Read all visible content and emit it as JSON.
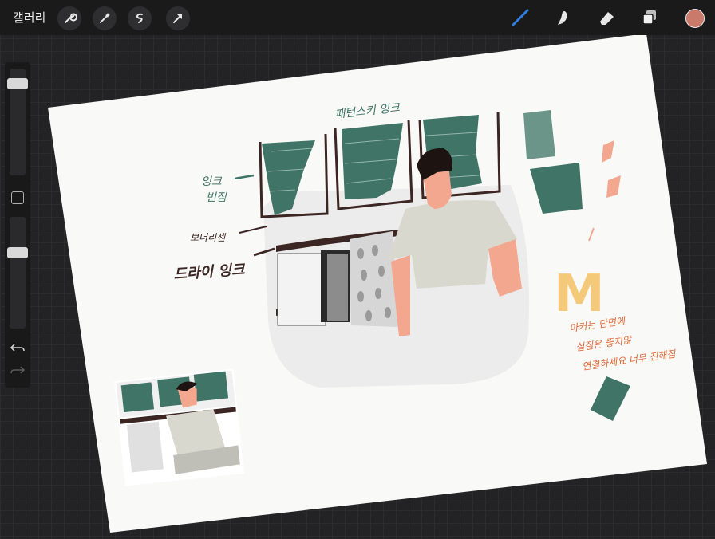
{
  "topbar": {
    "gallery_label": "갤러리",
    "left_tools": [
      "wrench-icon",
      "magic-wand-icon",
      "selection-icon",
      "transform-arrow-icon"
    ],
    "right_tools": [
      "brush-icon",
      "smudge-icon",
      "eraser-icon",
      "layers-icon"
    ],
    "active_tool": "brush-icon",
    "current_color": "#c97a6b",
    "active_tool_color": "#2f7fe0"
  },
  "sidebar": {
    "brush_size_level": 0.9,
    "opacity_level": 0.7,
    "undo_icon": "undo-icon",
    "redo_icon": "redo-icon"
  },
  "canvas": {
    "annotations": {
      "top_label": "패턴스키 잉크",
      "ink_label_line1": "잉크",
      "ink_label_line2": "번짐",
      "label_beside": "보더리센",
      "label_dry_ink": "드라이 잉크",
      "m_letter": "M",
      "orange_note_line1": "마커는 단면에",
      "orange_note_line2": "실질은 좋지않",
      "orange_note_line3": "연결하세요 너무 진해짐"
    },
    "colors": {
      "paper": "#f9f9f7",
      "green": "#3f7466",
      "dark_brown": "#3c2623",
      "peach": "#f2a78e",
      "marker_yellow": "#f5c97a",
      "orange_text": "#e06a3a",
      "shirt": "#d8d8cf"
    }
  }
}
